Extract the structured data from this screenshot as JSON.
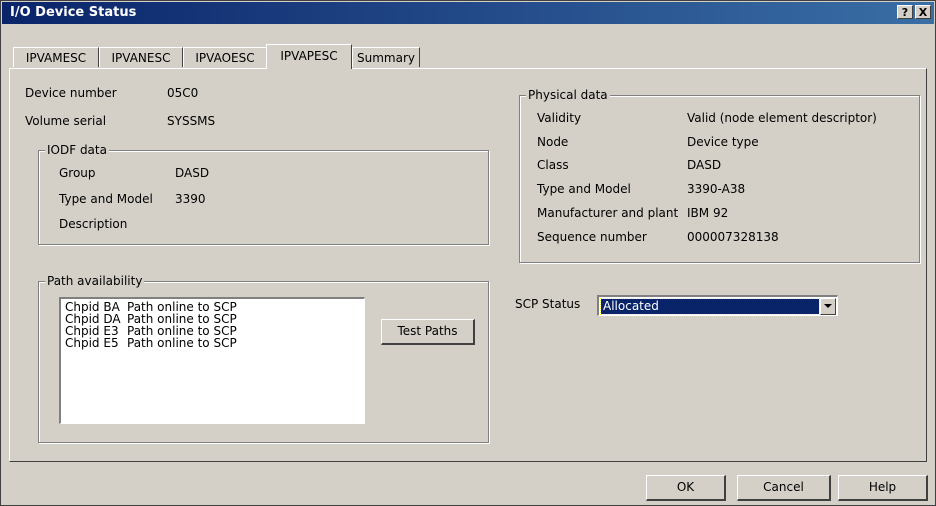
{
  "window": {
    "title": "I/O Device Status",
    "help_btn": "?",
    "close_btn": "X"
  },
  "tabs": [
    {
      "label": "IPVAMESC",
      "active": false
    },
    {
      "label": "IPVANESC",
      "active": false
    },
    {
      "label": "IPVAOESC",
      "active": false
    },
    {
      "label": "IPVAPESC",
      "active": true
    },
    {
      "label": "Summary",
      "active": false
    }
  ],
  "device": {
    "number_label": "Device number",
    "number_value": "05C0",
    "volser_label": "Volume serial",
    "volser_value": "SYSSMS"
  },
  "iodf": {
    "title": "IODF data",
    "group_label": "Group",
    "group_value": "DASD",
    "type_label": "Type and Model",
    "type_value": "3390",
    "desc_label": "Description",
    "desc_value": ""
  },
  "physical": {
    "title": "Physical data",
    "rows": [
      {
        "label": "Validity",
        "value": "Valid (node element descriptor)"
      },
      {
        "label": "Node",
        "value": "Device type"
      },
      {
        "label": "Class",
        "value": "DASD"
      },
      {
        "label": "Type and Model",
        "value": "3390-A38"
      },
      {
        "label": "Manufacturer and plant",
        "value": "IBM 92"
      },
      {
        "label": "Sequence number",
        "value": "000007328138"
      }
    ]
  },
  "paths": {
    "title": "Path availability",
    "items": [
      {
        "chpid": "Chpid BA",
        "status": "Path online to SCP"
      },
      {
        "chpid": "Chpid DA",
        "status": "Path online to SCP"
      },
      {
        "chpid": "Chpid E3",
        "status": "Path online to SCP"
      },
      {
        "chpid": "Chpid E5",
        "status": "Path online to SCP"
      }
    ],
    "test_button": "Test Paths"
  },
  "scp": {
    "label": "SCP Status",
    "value": "Allocated"
  },
  "buttons": {
    "ok": "OK",
    "cancel": "Cancel",
    "help": "Help"
  }
}
